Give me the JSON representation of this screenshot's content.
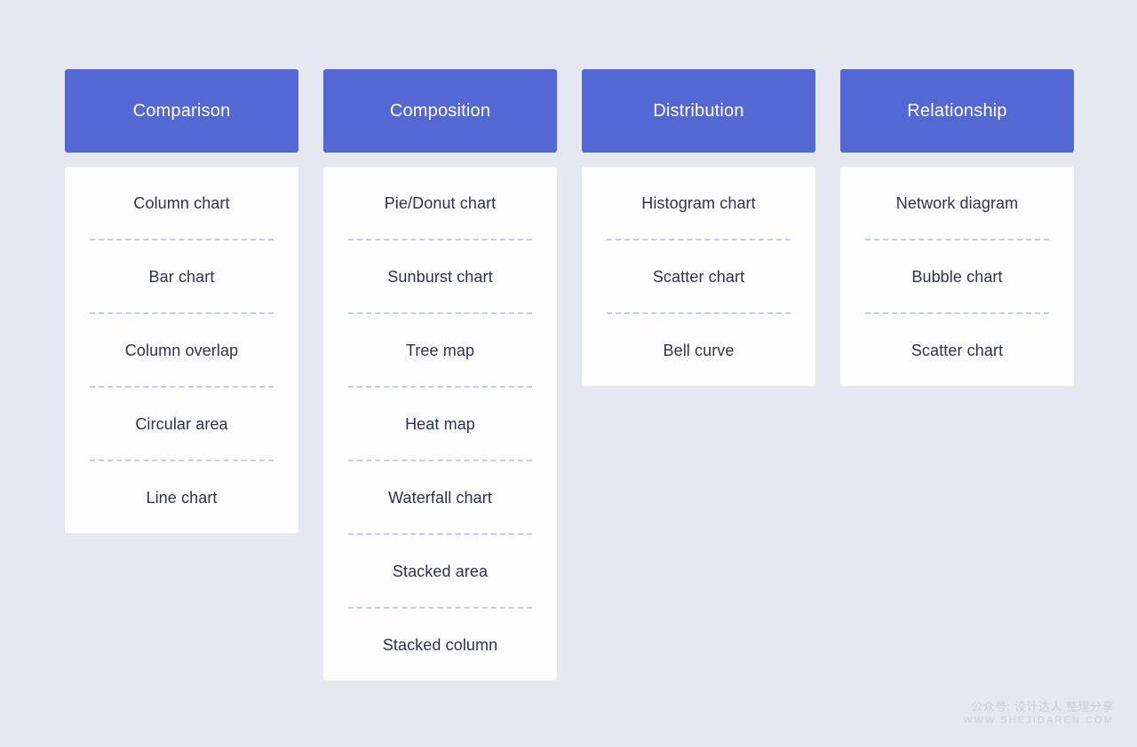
{
  "board": {
    "background_color": "#e5e8f0",
    "header_color": "#5468d4",
    "card_color": "#fdfdfe",
    "divider_color": "#c3cdf3",
    "text_color": "#2d3348",
    "columns": [
      {
        "title": "Comparison",
        "items": [
          "Column chart",
          "Bar chart",
          "Column overlap",
          "Circular area",
          "Line chart"
        ]
      },
      {
        "title": "Composition",
        "items": [
          "Pie/Donut chart",
          "Sunburst chart",
          "Tree map",
          "Heat map",
          "Waterfall chart",
          "Stacked area",
          "Stacked column"
        ]
      },
      {
        "title": "Distribution",
        "items": [
          "Histogram chart",
          "Scatter chart",
          "Bell curve"
        ]
      },
      {
        "title": "Relationship",
        "items": [
          "Network diagram",
          "Bubble chart",
          "Scatter chart"
        ]
      }
    ]
  },
  "watermark": {
    "line1": "公众号: 设计达人 整理分享",
    "line2": "WWW.SHEJIDAREN.COM"
  }
}
